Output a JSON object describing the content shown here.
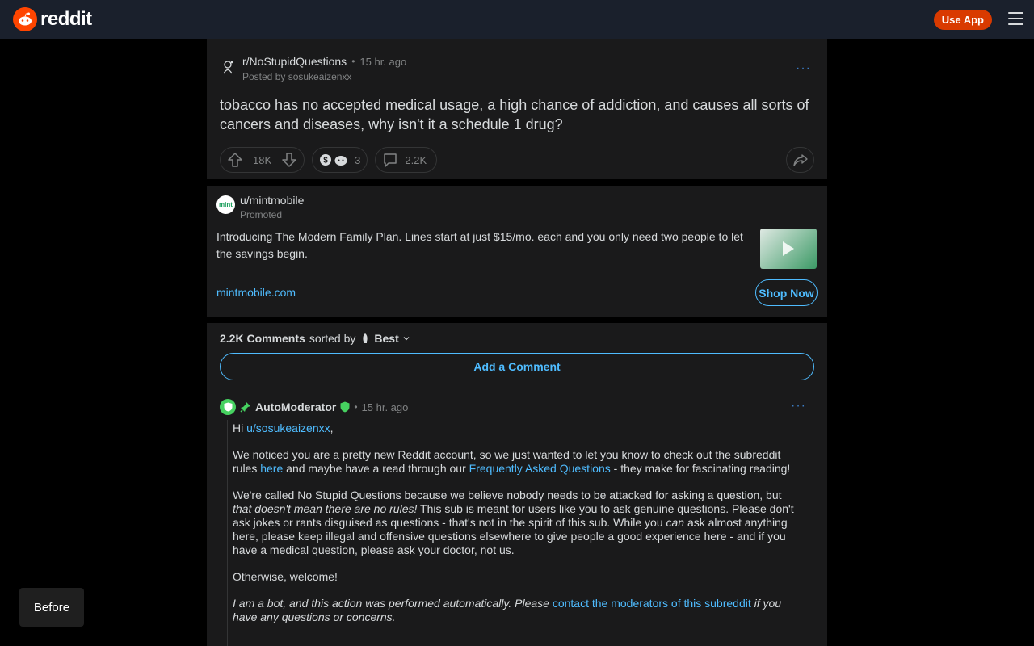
{
  "header": {
    "brand": "reddit",
    "use_app_label": "Use App"
  },
  "post": {
    "subreddit": "r/NoStupidQuestions",
    "separator": "•",
    "time": "15 hr. ago",
    "posted_by": "Posted by sosukeaizenxx",
    "more": "···",
    "title": "tobacco has no accepted medical usage, a high chance of addiction, and causes all sorts of cancers and diseases, why isn't it a schedule 1 drug?",
    "score": "18K",
    "awards_count": "3",
    "comments_count": "2.2K"
  },
  "ad": {
    "user": "u/mintmobile",
    "avatar_text": "mint",
    "promoted": "Promoted",
    "text": "Introducing The Modern Family Plan. Lines start at just $15/mo. each and you only need two people to let the savings begin.",
    "link": "mintmobile.com",
    "cta": "Shop Now"
  },
  "comments": {
    "count": "2.2K Comments",
    "sorted_by": "sorted by",
    "sort": "Best",
    "add_label": "Add a Comment",
    "first": {
      "author": "AutoModerator",
      "separator": "•",
      "time": "15 hr. ago",
      "more": "···",
      "greeting": "Hi ",
      "mention": "u/sosukeaizenxx",
      "greeting_end": ",",
      "p1_a": "We noticed you are a pretty new Reddit account, so we just wanted to let you know to check out the subreddit rules ",
      "p1_link1": "here",
      "p1_b": " and maybe have a read through our ",
      "p1_link2": "Frequently Asked Questions",
      "p1_c": " - they make for fascinating reading!",
      "p2_a": "We're called No Stupid Questions because we believe nobody needs to be attacked for asking a question, but ",
      "p2_em": "that doesn't mean there are no rules!",
      "p2_b": " This sub is meant for users like you to ask genuine questions. Please don't ask jokes or rants disguised as questions - that's not in the spirit of this sub. While you ",
      "p2_em2": "can",
      "p2_c": " ask almost anything here, please keep illegal and offensive questions elsewhere to give people a good experience here - and if you have a medical question, please ask your doctor, not us.",
      "p3": "Otherwise, welcome!",
      "p4_a": "I am a bot, and this action was performed automatically. Please ",
      "p4_link": "contact the moderators of this subreddit",
      "p4_b": " if you have any questions or concerns."
    }
  },
  "overlay": {
    "before_label": "Before"
  },
  "colors": {
    "accent": "#4fbcff",
    "brand": "#ff4500",
    "moderator": "#46d160"
  }
}
